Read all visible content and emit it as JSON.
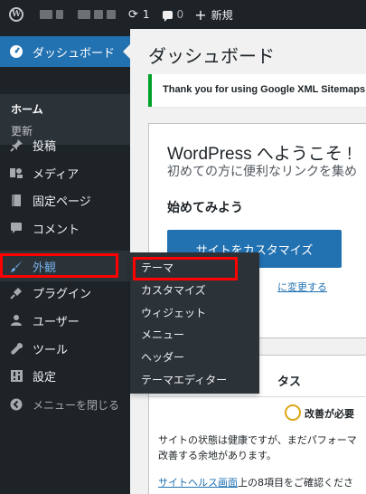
{
  "adminbar": {
    "update_count": "1",
    "comment_count": "0",
    "new_label": "新規"
  },
  "sidebar": {
    "dashboard": "ダッシュボード",
    "home": "ホーム",
    "update": "更新",
    "posts": "投稿",
    "media": "メディア",
    "pages": "固定ページ",
    "comments": "コメント",
    "appearance": "外観",
    "plugins": "プラグイン",
    "users": "ユーザー",
    "tools": "ツール",
    "settings": "設定",
    "collapse": "メニューを閉じる"
  },
  "flyout": {
    "items": [
      "テーマ",
      "カスタマイズ",
      "ウィジェット",
      "メニュー",
      "ヘッダー",
      "テーマエディター"
    ]
  },
  "main": {
    "title": "ダッシュボード",
    "notice": "Thank you for using Google XML Sitemaps",
    "welcome_title": "WordPress へようこそ !",
    "welcome_sub": "初めての方に便利なリンクを集め",
    "get_started": "始めてみよう",
    "customize_button": "サイトをカスタマイズ",
    "change_link": "に変更する",
    "health_title": "タス",
    "health_status": "改善が必要",
    "health_desc1": "サイトの状態は健康ですが、まだパフォーマ",
    "health_desc2": "改善する余地があります。",
    "health_link": "サイトヘルス画面",
    "health_link_suffix": "上の8項目をご確認くださ"
  }
}
